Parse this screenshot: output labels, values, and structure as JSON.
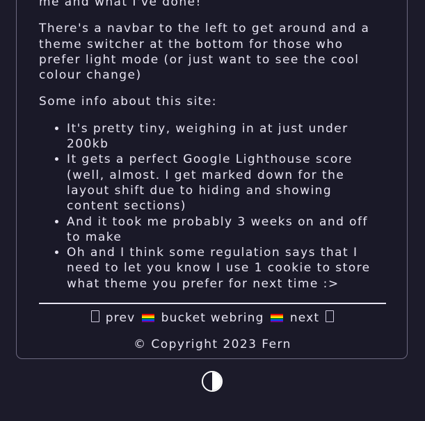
{
  "intro": {
    "partial_line": "me and what I've done!",
    "navbar_paragraph": "There's a navbar to the left to get around and a theme switcher at the bottom for those who prefer light mode (or just want to see the cool colour change)",
    "site_info_heading": "Some info about this site:"
  },
  "info_items": [
    "It's pretty tiny, weighing in at just under 200kb",
    "It gets a perfect Google Lighthouse score (well, almost. I get marked down for the layout shift due to hiding and showing content sections)",
    "And it took me probably 3 weeks on and off to make",
    "Oh and I think some regulation says that I need to let you know I use 1 cookie to store what theme you prefer for next time :>"
  ],
  "webring": {
    "prev_label": "prev",
    "ring_label": "bucket webring",
    "next_label": "next"
  },
  "footer": {
    "copyright": "© Copyright 2023 Fern"
  },
  "theme_toggle": {
    "icon": "half-circle-contrast-icon"
  },
  "colors": {
    "background": "#1c1b2a",
    "card_border": "#6e6a82",
    "text": "#e7e4f2"
  }
}
